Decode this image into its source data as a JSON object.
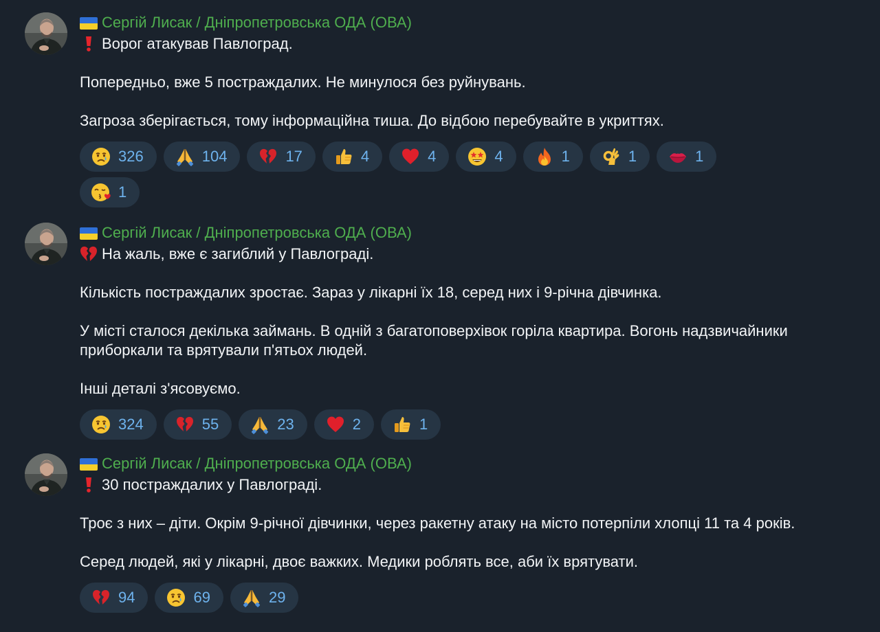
{
  "messages": [
    {
      "author": "Сергій Лисак / Дніпропетровська ОДА (ОВА)",
      "lead_icon": "exclamation-icon",
      "paragraphs": [
        "Ворог атакував Павлоград.",
        "Попередньо, вже 5 постраждалих. Не минулося без руйнувань.",
        "Загроза зберігається, тому інформаційна тиша. До відбою перебувайте в укриттях."
      ],
      "reactions": [
        {
          "icon": "crying-face-icon",
          "count": "326"
        },
        {
          "icon": "praying-hands-icon",
          "count": "104"
        },
        {
          "icon": "broken-heart-icon",
          "count": "17"
        },
        {
          "icon": "thumbs-up-icon",
          "count": "4"
        },
        {
          "icon": "red-heart-icon",
          "count": "4"
        },
        {
          "icon": "star-struck-icon",
          "count": "4"
        },
        {
          "icon": "fire-icon",
          "count": "1"
        },
        {
          "icon": "ok-hand-icon",
          "count": "1"
        },
        {
          "icon": "kiss-mark-icon",
          "count": "1"
        },
        {
          "icon": "face-blowing-kiss-icon",
          "count": "1"
        }
      ]
    },
    {
      "author": "Сергій Лисак / Дніпропетровська ОДА (ОВА)",
      "lead_icon": "broken-heart-icon",
      "paragraphs": [
        "На жаль, вже є загиблий у Павлограді.",
        "Кількість постраждалих зростає. Зараз у лікарні їх 18, серед них і 9-річна дівчинка.",
        "У місті сталося декілька займань. В одній з багатоповерхівок горіла квартира. Вогонь надзвичайники приборкали та врятували п'ятьох людей.",
        "Інші деталі з'ясовуємо."
      ],
      "reactions": [
        {
          "icon": "crying-face-icon",
          "count": "324"
        },
        {
          "icon": "broken-heart-icon",
          "count": "55"
        },
        {
          "icon": "praying-hands-icon",
          "count": "23"
        },
        {
          "icon": "red-heart-icon",
          "count": "2"
        },
        {
          "icon": "thumbs-up-icon",
          "count": "1"
        }
      ]
    },
    {
      "author": "Сергій Лисак / Дніпропетровська ОДА (ОВА)",
      "lead_icon": "exclamation-icon",
      "paragraphs": [
        "30 постраждалих у Павлограді.",
        "Троє з них – діти. Окрім 9-річної дівчинки, через ракетну атаку на місто потерпіли хлопці 11 та 4 років.",
        "Серед людей, які у лікарні, двоє важких. Медики роблять все, аби їх врятувати."
      ],
      "reactions": [
        {
          "icon": "broken-heart-icon",
          "count": "94"
        },
        {
          "icon": "crying-face-icon",
          "count": "69"
        },
        {
          "icon": "praying-hands-icon",
          "count": "29"
        }
      ]
    }
  ],
  "colors": {
    "background": "#1a222c",
    "author": "#4fae4e",
    "text": "#f2f4f6",
    "chip": "#263544",
    "count": "#6eb3ee"
  }
}
